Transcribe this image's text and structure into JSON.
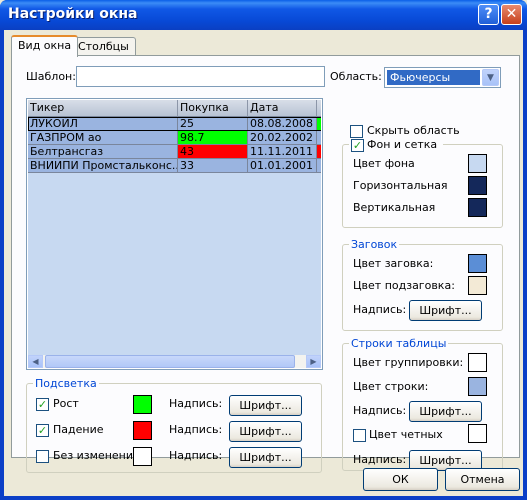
{
  "window": {
    "title": "Настройки окна",
    "help_glyph": "?",
    "close_glyph": "✕"
  },
  "tabs": [
    {
      "label": "Вид окна"
    },
    {
      "label": "Столбцы"
    }
  ],
  "template": {
    "label": "Шаблон:",
    "value": ""
  },
  "area": {
    "label": "Область:",
    "selected": "Фьючерсы"
  },
  "grid": {
    "columns": [
      "Тикер",
      "Покупка",
      "Дата"
    ],
    "rows": [
      {
        "ticker": "ЛУКОЙЛ",
        "buy": "25",
        "date": "08.08.2008",
        "buy_color": "",
        "extra_color": "#00ff00"
      },
      {
        "ticker": "ГАЗПРОМ ао",
        "buy": "98.7",
        "date": "20.02.2002",
        "buy_color": "#00ff00",
        "extra_color": ""
      },
      {
        "ticker": "Белтрансгаз",
        "buy": "43",
        "date": "11.11.2011",
        "buy_color": "#ff0000",
        "extra_color": "#ff0000"
      },
      {
        "ticker": "ВНИИПИ Промстальконс...",
        "buy": "33",
        "date": "01.01.2001",
        "buy_color": "",
        "extra_color": ""
      }
    ]
  },
  "highlight": {
    "title": "Подсветка",
    "items": [
      {
        "label": "Рост",
        "checked": true,
        "color": "#00ff00",
        "caption": "Надпись:",
        "button": "Шрифт..."
      },
      {
        "label": "Падение",
        "checked": true,
        "color": "#ff0000",
        "caption": "Надпись:",
        "button": "Шрифт..."
      },
      {
        "label": "Без изменений",
        "checked": false,
        "color": "#ffffff",
        "caption": "Надпись:",
        "button": "Шрифт..."
      }
    ]
  },
  "hide_area": {
    "label": "Скрыть область",
    "checked": false
  },
  "background": {
    "title": "Фон и сетка",
    "checked": true,
    "items": [
      {
        "label": "Цвет фона",
        "color": "#c7d9f1"
      },
      {
        "label": "Горизонтальная",
        "color": "#14285a"
      },
      {
        "label": "Вертикальная",
        "color": "#14285a"
      }
    ]
  },
  "header": {
    "title": "Заговок",
    "items": [
      {
        "label": "Цвет заговка:",
        "color": "#5b8ed6"
      },
      {
        "label": "Цвет подзаговка:",
        "color": "#f3ead6"
      }
    ],
    "caption": "Надпись:",
    "button": "Шрифт..."
  },
  "table_rows": {
    "title": "Строки таблицы",
    "items": [
      {
        "label": "Цвет группировки:",
        "color": "#ffffff"
      },
      {
        "label": "Цвет строки:",
        "color": "#9ab4e0"
      }
    ],
    "caption": "Надпись:",
    "button": "Шрифт...",
    "even": {
      "label": "Цвет четных",
      "checked": false,
      "color": "#ffffff"
    },
    "caption2": "Надпись:",
    "button2": "Шрифт..."
  },
  "footer": {
    "ok": "ОК",
    "cancel": "Отмена"
  }
}
